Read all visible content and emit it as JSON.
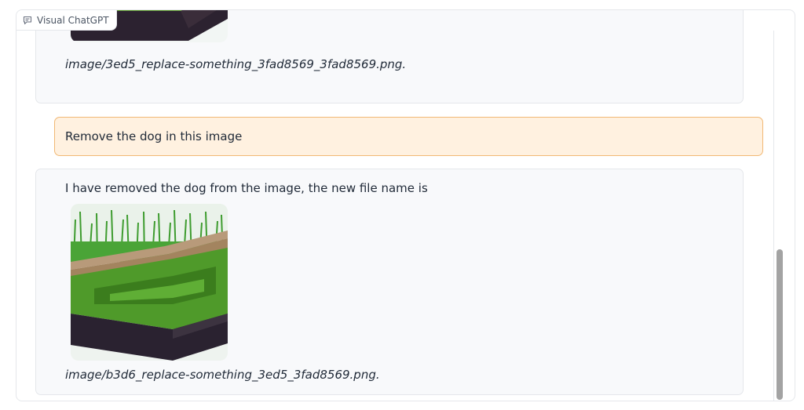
{
  "app": {
    "title": "Visual ChatGPT",
    "icon": "chat-bubble-icon"
  },
  "messages": [
    {
      "role": "bot",
      "image_alt": "planter box with grass",
      "filename": "image/3ed5_replace-something_3fad8569_3fad8569.png."
    },
    {
      "role": "user",
      "text": "Remove the dog in this image"
    },
    {
      "role": "bot",
      "text": "I have removed the dog from the image, the new file name is",
      "image_alt": "planter box with grass, dog removed",
      "filename": "image/b3d6_replace-something_3ed5_3fad8569.png."
    }
  ],
  "colors": {
    "user_bubble_bg": "#fff1e0",
    "user_bubble_border": "#f1b874",
    "bot_bubble_bg": "#f8f9fb"
  }
}
